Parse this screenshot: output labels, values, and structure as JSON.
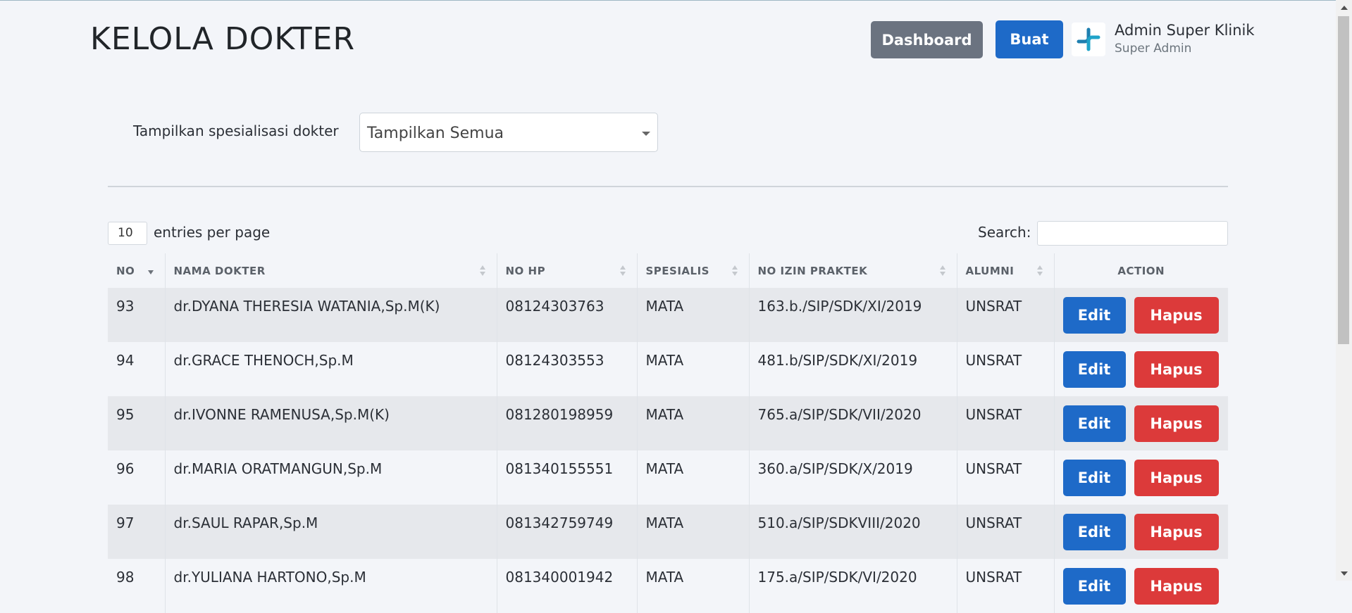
{
  "header": {
    "title": "KELOLA DOKTER",
    "dashboard_label": "Dashboard",
    "create_label": "Buat",
    "user_name": "Admin Super Klinik",
    "user_role": "Super Admin",
    "logo_icon": "medical-cross-logo"
  },
  "filter": {
    "label": "Tampilkan spesialisasi dokter",
    "selected": "Tampilkan Semua"
  },
  "table_controls": {
    "entries_value": "10",
    "entries_label": "entries per page",
    "search_label": "Search:",
    "search_value": ""
  },
  "table": {
    "columns": [
      "NO",
      "NAMA DOKTER",
      "NO HP",
      "SPESIALIS",
      "NO IZIN PRAKTEK",
      "ALUMNI",
      "ACTION"
    ],
    "sorted_column": "NO",
    "sort_direction": "desc",
    "edit_label": "Edit",
    "delete_label": "Hapus",
    "rows": [
      {
        "no": "93",
        "nama": "dr.DYANA THERESIA WATANIA,Sp.M(K)",
        "hp": "08124303763",
        "spesialis": "MATA",
        "izin": "163.b./SIP/SDK/XI/2019",
        "alumni": "UNSRAT"
      },
      {
        "no": "94",
        "nama": "dr.GRACE THENOCH,Sp.M",
        "hp": "08124303553",
        "spesialis": "MATA",
        "izin": "481.b/SIP/SDK/XI/2019",
        "alumni": "UNSRAT"
      },
      {
        "no": "95",
        "nama": "dr.IVONNE RAMENUSA,Sp.M(K)",
        "hp": "081280198959",
        "spesialis": "MATA",
        "izin": "765.a/SIP/SDK/VII/2020",
        "alumni": "UNSRAT"
      },
      {
        "no": "96",
        "nama": "dr.MARIA ORATMANGUN,Sp.M",
        "hp": "081340155551",
        "spesialis": "MATA",
        "izin": "360.a/SIP/SDK/X/2019",
        "alumni": "UNSRAT"
      },
      {
        "no": "97",
        "nama": "dr.SAUL RAPAR,Sp.M",
        "hp": "081342759749",
        "spesialis": "MATA",
        "izin": "510.a/SIP/SDKVIII/2020",
        "alumni": "UNSRAT"
      },
      {
        "no": "98",
        "nama": "dr.YULIANA HARTONO,Sp.M",
        "hp": "081340001942",
        "spesialis": "MATA",
        "izin": "175.a/SIP/SDK/VI/2020",
        "alumni": "UNSRAT"
      }
    ]
  },
  "colors": {
    "primary": "#1e6ac8",
    "danger": "#dc3a3a",
    "secondary": "#6b7380",
    "background": "#f3f5f9"
  }
}
